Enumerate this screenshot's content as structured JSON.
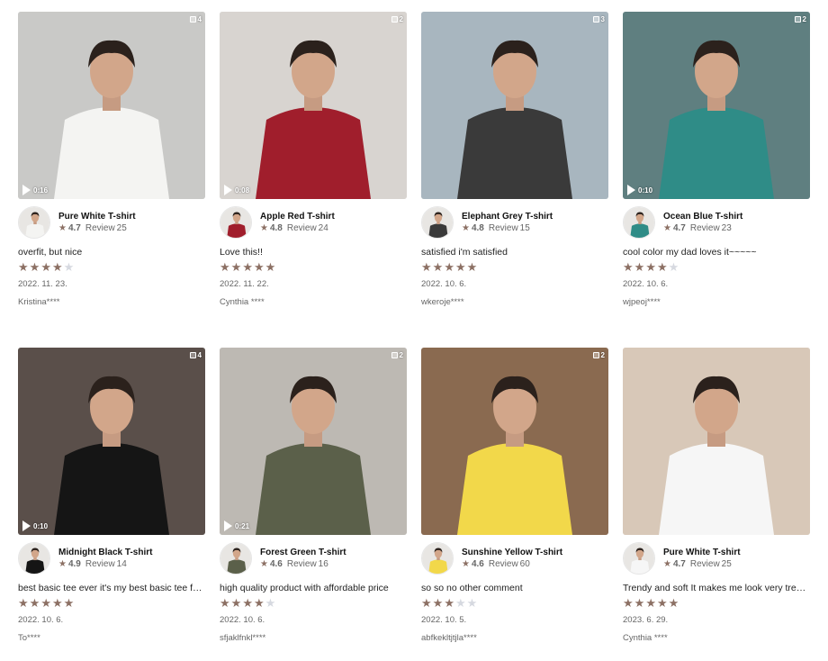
{
  "colors": {
    "star_filled": "#8c7064",
    "star_empty": "#d6d9e0",
    "text_muted": "#666666"
  },
  "reviews": [
    {
      "product": "Pure White T-shirt",
      "rating": "4.7",
      "review_label": "Review",
      "review_count": "25",
      "media_count": "4",
      "video_duration": "0:16",
      "comment": "overfit, but nice",
      "stars": 4,
      "date": "2022. 11. 23.",
      "author": "Kristina****",
      "bg": "#c9c9c7",
      "shirt": "#f4f4f2"
    },
    {
      "product": "Apple Red T-shirt",
      "rating": "4.8",
      "review_label": "Review",
      "review_count": "24",
      "media_count": "2",
      "video_duration": "0:08",
      "comment": "Love this!!",
      "stars": 5,
      "date": "2022. 11. 22.",
      "author": "Cynthia ****",
      "bg": "#d8d4d0",
      "shirt": "#a01e2c"
    },
    {
      "product": "Elephant Grey T-shirt",
      "rating": "4.8",
      "review_label": "Review",
      "review_count": "15",
      "media_count": "3",
      "video_duration": "",
      "comment": "satisfied i'm satisfied",
      "stars": 5,
      "date": "2022. 10. 6.",
      "author": "wkeroje****",
      "bg": "#a8b6bf",
      "shirt": "#3a3a3a"
    },
    {
      "product": "Ocean Blue T-shirt",
      "rating": "4.7",
      "review_label": "Review",
      "review_count": "23",
      "media_count": "2",
      "video_duration": "0:10",
      "comment": "cool color my dad loves it~~~~~",
      "stars": 4,
      "date": "2022. 10. 6.",
      "author": "wjpeoj****",
      "bg": "#5f7f80",
      "shirt": "#2f8c87"
    },
    {
      "product": "Midnight Black T-shirt",
      "rating": "4.9",
      "review_label": "Review",
      "review_count": "14",
      "media_count": "4",
      "video_duration": "0:10",
      "comment": "best basic tee ever it's my best basic tee for this year",
      "stars": 5,
      "date": "2022. 10. 6.",
      "author": "To****",
      "bg": "#5a4f4a",
      "shirt": "#151515"
    },
    {
      "product": "Forest Green T-shirt",
      "rating": "4.6",
      "review_label": "Review",
      "review_count": "16",
      "media_count": "2",
      "video_duration": "0:21",
      "comment": "high quality product with affordable price",
      "stars": 4,
      "date": "2022. 10. 6.",
      "author": "sfjaklfnkl****",
      "bg": "#bdb9b3",
      "shirt": "#5b604a"
    },
    {
      "product": "Sunshine Yellow T-shirt",
      "rating": "4.6",
      "review_label": "Review",
      "review_count": "60",
      "media_count": "2",
      "video_duration": "",
      "comment": "so so no other comment",
      "stars": 3,
      "date": "2022. 10. 5.",
      "author": "abfkekltjtjla****",
      "bg": "#8a6a50",
      "shirt": "#f2d84a"
    },
    {
      "product": "Pure White T-shirt",
      "rating": "4.7",
      "review_label": "Review",
      "review_count": "25",
      "media_count": "",
      "video_duration": "",
      "comment": "Trendy and soft It makes me look very trendy and cool",
      "stars": 5,
      "date": "2023. 6. 29.",
      "author": "Cynthia ****",
      "bg": "#d8c8b8",
      "shirt": "#f6f6f6"
    }
  ]
}
